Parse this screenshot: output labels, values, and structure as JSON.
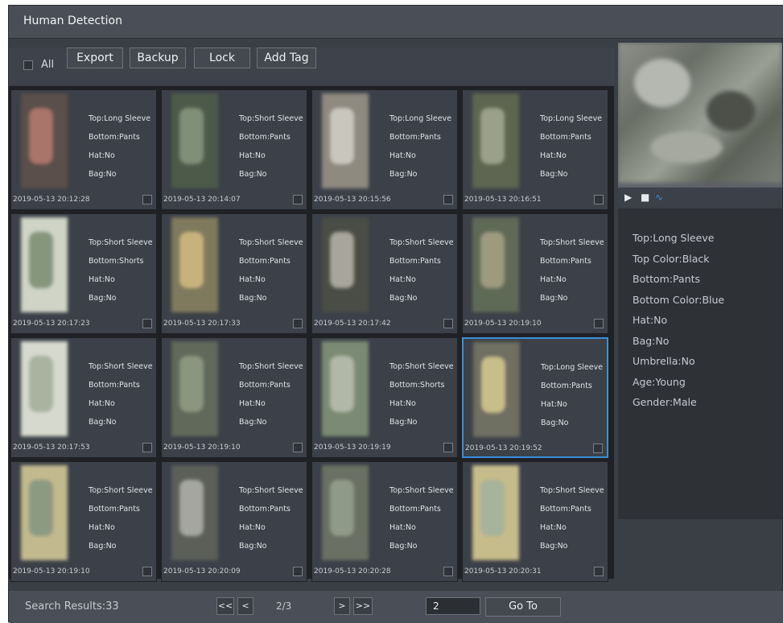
{
  "window": {
    "title": "Human Detection"
  },
  "toolbar": {
    "all_label": "All",
    "buttons": [
      "Export",
      "Backup",
      "Lock",
      "Add Tag"
    ]
  },
  "results": [
    {
      "top": "Top:Long Sleeve",
      "bottom": "Bottom:Pants",
      "hat": "Hat:No",
      "bag": "Bag:No",
      "time": "2019-05-13 20:12:28"
    },
    {
      "top": "Top:Short Sleeve",
      "bottom": "Bottom:Pants",
      "hat": "Hat:No",
      "bag": "Bag:No",
      "time": "2019-05-13 20:14:07"
    },
    {
      "top": "Top:Long Sleeve",
      "bottom": "Bottom:Pants",
      "hat": "Hat:No",
      "bag": "Bag:No",
      "time": "2019-05-13 20:15:56"
    },
    {
      "top": "Top:Long Sleeve",
      "bottom": "Bottom:Pants",
      "hat": "Hat:No",
      "bag": "Bag:No",
      "time": "2019-05-13 20:16:51"
    },
    {
      "top": "Top:Short Sleeve",
      "bottom": "Bottom:Shorts",
      "hat": "Hat:No",
      "bag": "Bag:No",
      "time": "2019-05-13 20:17:23"
    },
    {
      "top": "Top:Short Sleeve",
      "bottom": "Bottom:Pants",
      "hat": "Hat:No",
      "bag": "Bag:No",
      "time": "2019-05-13 20:17:33"
    },
    {
      "top": "Top:Short Sleeve",
      "bottom": "Bottom:Pants",
      "hat": "Hat:No",
      "bag": "Bag:No",
      "time": "2019-05-13 20:17:42"
    },
    {
      "top": "Top:Short Sleeve",
      "bottom": "Bottom:Pants",
      "hat": "Hat:No",
      "bag": "Bag:No",
      "time": "2019-05-13 20:19:10"
    },
    {
      "top": "Top:Short Sleeve",
      "bottom": "Bottom:Pants",
      "hat": "Hat:No",
      "bag": "Bag:No",
      "time": "2019-05-13 20:17:53"
    },
    {
      "top": "Top:Short Sleeve",
      "bottom": "Bottom:Pants",
      "hat": "Hat:No",
      "bag": "Bag:No",
      "time": "2019-05-13 20:19:10"
    },
    {
      "top": "Top:Short Sleeve",
      "bottom": "Bottom:Shorts",
      "hat": "Hat:No",
      "bag": "Bag:No",
      "time": "2019-05-13 20:19:19"
    },
    {
      "top": "Top:Long Sleeve",
      "bottom": "Bottom:Pants",
      "hat": "Hat:No",
      "bag": "Bag:No",
      "time": "2019-05-13 20:19:52",
      "selected": true
    },
    {
      "top": "Top:Short Sleeve",
      "bottom": "Bottom:Pants",
      "hat": "Hat:No",
      "bag": "Bag:No",
      "time": "2019-05-13 20:19:10"
    },
    {
      "top": "Top:Short Sleeve",
      "bottom": "Bottom:Pants",
      "hat": "Hat:No",
      "bag": "Bag:No",
      "time": "2019-05-13 20:20:09"
    },
    {
      "top": "Top:Short Sleeve",
      "bottom": "Bottom:Pants",
      "hat": "Hat:No",
      "bag": "Bag:No",
      "time": "2019-05-13 20:20:28"
    },
    {
      "top": "Top:Short Sleeve",
      "bottom": "Bottom:Pants",
      "hat": "Hat:No",
      "bag": "Bag:No",
      "time": "2019-05-13 20:20:31"
    }
  ],
  "details": {
    "top": "Top:Long Sleeve",
    "top_color": "Top Color:Black",
    "bottom": "Bottom:Pants",
    "bottom_color": "Bottom Color:Blue",
    "hat": "Hat:No",
    "bag": "Bag:No",
    "umbrella": "Umbrella:No",
    "age": "Age:Young",
    "gender": "Gender:Male"
  },
  "player": {
    "icons": [
      "play-icon",
      "stop-icon",
      "waveform-icon"
    ]
  },
  "footer": {
    "search_results": "Search Results:33",
    "first_label": "<<",
    "prev_label": "<",
    "page_info": "2/3",
    "next_label": ">",
    "last_label": ">>",
    "page_input_value": "2",
    "goto_label": "Go To"
  },
  "colors": {
    "selection": "#3a8fd9",
    "background": "#3a3e45",
    "titlebar": "#4a4e56"
  }
}
